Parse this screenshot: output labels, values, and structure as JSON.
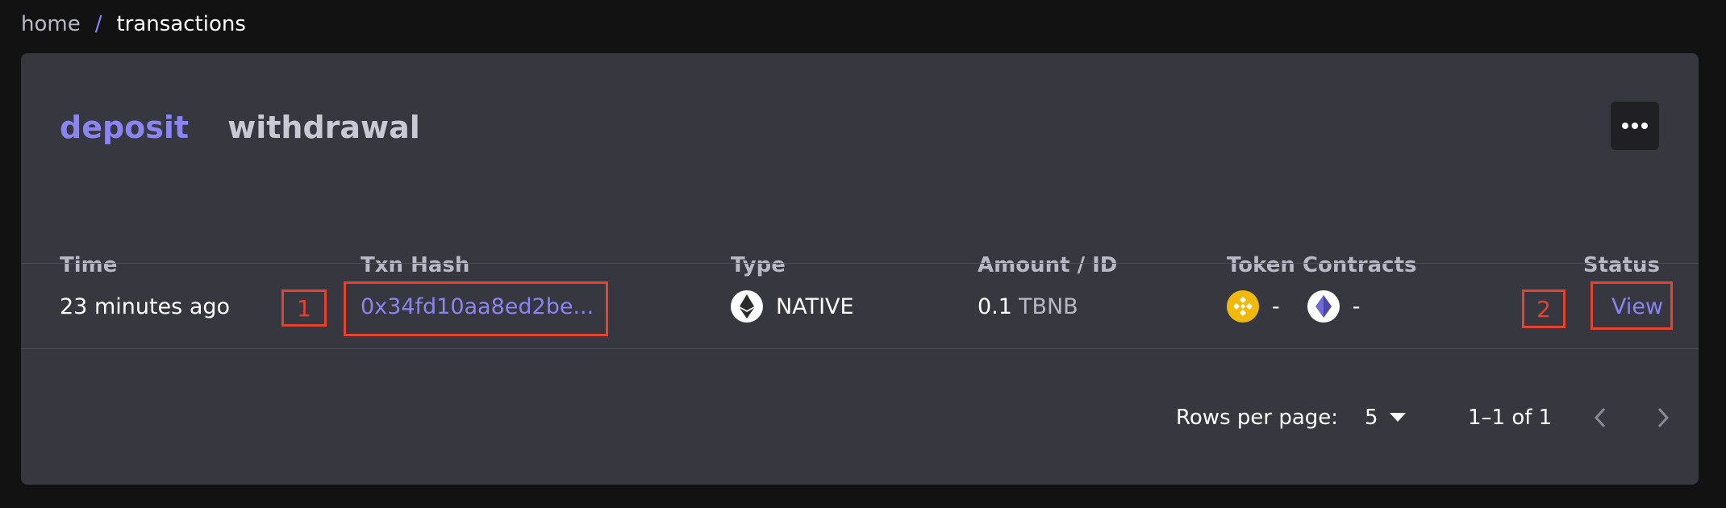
{
  "breadcrumb": {
    "home": "home",
    "separator": "/",
    "current": "transactions"
  },
  "tabs": [
    {
      "label": "deposit",
      "active": true
    },
    {
      "label": "withdrawal",
      "active": false
    }
  ],
  "more_button": {
    "icon": "more-horizontal-icon"
  },
  "table": {
    "headers": {
      "time": "Time",
      "hash": "Txn Hash",
      "type": "Type",
      "amount": "Amount / ID",
      "tokens": "Token Contracts",
      "status": "Status"
    },
    "rows": [
      {
        "time": "23 minutes ago",
        "hash": "0x34fd10aa8ed2be...",
        "type": "NATIVE",
        "type_icon": "ethereum-icon",
        "amount": "0.1",
        "amount_unit": "TBNB",
        "token_1_icon": "bnb-icon",
        "token_1": "-",
        "token_2_icon": "ethereum-icon",
        "token_2": "-",
        "status_action": "View"
      }
    ]
  },
  "markers": {
    "marker_1": "1",
    "marker_2": "2"
  },
  "pagination": {
    "rows_per_page_label": "Rows per page:",
    "rows_per_page_value": "5",
    "range": "1–1 of 1"
  },
  "colors": {
    "accent": "#8b85f2",
    "card_background": "#373740",
    "page_background": "#121213",
    "annotation_red": "#e5432f",
    "bnb_yellow": "#f0b90b"
  }
}
